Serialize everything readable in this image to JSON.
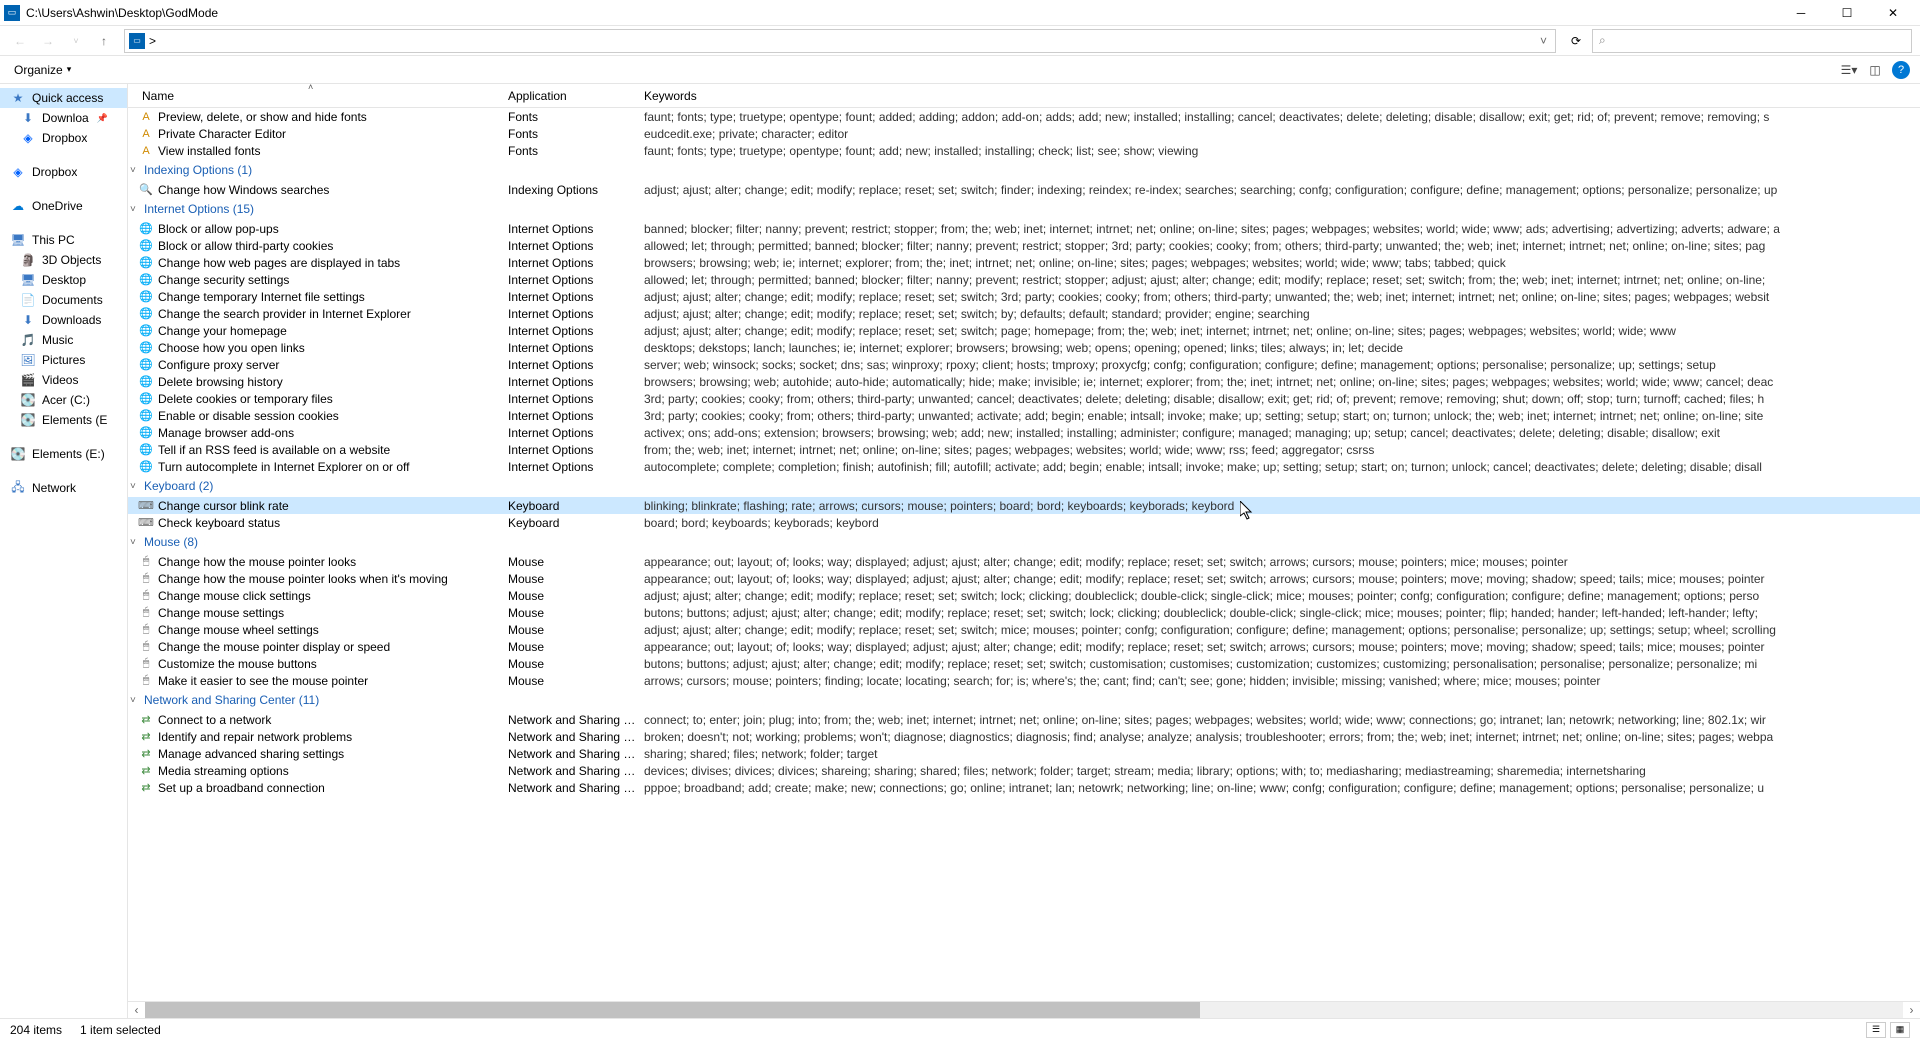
{
  "window": {
    "title": "C:\\Users\\Ashwin\\Desktop\\GodMode",
    "address": ">"
  },
  "toolbar": {
    "organize": "Organize"
  },
  "search": {
    "placeholder": ""
  },
  "sidebar": {
    "quick_access": "Quick access",
    "downloads_pin": "Downloa",
    "dropbox_pin": "Dropbox",
    "dropbox": "Dropbox",
    "onedrive": "OneDrive",
    "this_pc": "This PC",
    "objects3d": "3D Objects",
    "desktop": "Desktop",
    "documents": "Documents",
    "downloads": "Downloads",
    "music": "Music",
    "pictures": "Pictures",
    "videos": "Videos",
    "acer_c": "Acer (C:)",
    "elements_e1": "Elements (E",
    "elements_e2": "Elements (E:)",
    "network": "Network"
  },
  "columns": {
    "name": "Name",
    "app": "Application",
    "key": "Keywords"
  },
  "groups": [
    {
      "label": "",
      "items": [
        {
          "name": "Preview, delete, or show and hide fonts",
          "app": "Fonts",
          "key": "faunt; fonts; type; truetype; opentype; fount; added; adding; addon; add-on; adds; add; new; installed; installing; cancel; deactivates; delete; deleting; disable; disallow; exit; get; rid; of; prevent; remove; removing; s",
          "icon": "A",
          "ic": "#d08a00"
        },
        {
          "name": "Private Character Editor",
          "app": "Fonts",
          "key": "eudcedit.exe; private; character; editor",
          "icon": "A",
          "ic": "#d08a00"
        },
        {
          "name": "View installed fonts",
          "app": "Fonts",
          "key": "faunt; fonts; type; truetype; opentype; fount; add; new; installed; installing; check; list; see; show; viewing",
          "icon": "A",
          "ic": "#d08a00"
        }
      ]
    },
    {
      "label": "Indexing Options (1)",
      "items": [
        {
          "name": "Change how Windows searches",
          "app": "Indexing Options",
          "key": "adjust; ajust; alter; change; edit; modify; replace; reset; set; switch; finder; indexing; reindex; re-index; searches; searching; confg; configuration; configure; define; management; options; personalize; personalize; up",
          "icon": "🔍",
          "ic": "#888"
        }
      ]
    },
    {
      "label": "Internet Options (15)",
      "items": [
        {
          "name": "Block or allow pop-ups",
          "app": "Internet Options",
          "key": "banned; blocker; filter; nanny; prevent; restrict; stopper; from; the; web; inet; internet; intrnet; net; online; on-line; sites; pages; webpages; websites; world; wide; www; ads; advertising; advertizing; adverts; adware; a",
          "icon": "🌐",
          "ic": "#3b78c4"
        },
        {
          "name": "Block or allow third-party cookies",
          "app": "Internet Options",
          "key": "allowed; let; through; permitted; banned; blocker; filter; nanny; prevent; restrict; stopper; 3rd; party; cookies; cooky; from; others; third-party; unwanted; the; web; inet; internet; intrnet; net; online; on-line; sites; pag",
          "icon": "🌐",
          "ic": "#3b78c4"
        },
        {
          "name": "Change how web pages are displayed in tabs",
          "app": "Internet Options",
          "key": "browsers; browsing; web; ie; internet; explorer; from; the; inet; intrnet; net; online; on-line; sites; pages; webpages; websites; world; wide; www; tabs; tabbed; quick",
          "icon": "🌐",
          "ic": "#3b78c4"
        },
        {
          "name": "Change security settings",
          "app": "Internet Options",
          "key": "allowed; let; through; permitted; banned; blocker; filter; nanny; prevent; restrict; stopper; adjust; ajust; alter; change; edit; modify; replace; reset; set; switch; from; the; web; inet; internet; intrnet; net; online; on-line;",
          "icon": "🌐",
          "ic": "#3b78c4"
        },
        {
          "name": "Change temporary Internet file settings",
          "app": "Internet Options",
          "key": "adjust; ajust; alter; change; edit; modify; replace; reset; set; switch; 3rd; party; cookies; cooky; from; others; third-party; unwanted; the; web; inet; internet; intrnet; net; online; on-line; sites; pages; webpages; websit",
          "icon": "🌐",
          "ic": "#3b78c4"
        },
        {
          "name": "Change the search provider in Internet Explorer",
          "app": "Internet Options",
          "key": "adjust; ajust; alter; change; edit; modify; replace; reset; set; switch; by; defaults; default; standard; provider; engine; searching",
          "icon": "🌐",
          "ic": "#3b78c4"
        },
        {
          "name": "Change your homepage",
          "app": "Internet Options",
          "key": "adjust; ajust; alter; change; edit; modify; replace; reset; set; switch; page; homepage; from; the; web; inet; internet; intrnet; net; online; on-line; sites; pages; webpages; websites; world; wide; www",
          "icon": "🌐",
          "ic": "#3b78c4"
        },
        {
          "name": "Choose how you open links",
          "app": "Internet Options",
          "key": "desktops; dekstops; lanch; launches; ie; internet; explorer; browsers; browsing; web; opens; opening; opened; links; tiles; always; in; let; decide",
          "icon": "🌐",
          "ic": "#3b78c4"
        },
        {
          "name": "Configure proxy server",
          "app": "Internet Options",
          "key": "server; web; winsock; socks; socket; dns; sas; winproxy; rpoxy; client; hosts; tmproxy; proxycfg; confg; configuration; configure; define; management; options; personalise; personalize; up; settings; setup",
          "icon": "🌐",
          "ic": "#3b78c4"
        },
        {
          "name": "Delete browsing history",
          "app": "Internet Options",
          "key": "browsers; browsing; web; autohide; auto-hide; automatically; hide; make; invisible; ie; internet; explorer; from; the; inet; intrnet; net; online; on-line; sites; pages; webpages; websites; world; wide; www; cancel; deac",
          "icon": "🌐",
          "ic": "#3b78c4"
        },
        {
          "name": "Delete cookies or temporary files",
          "app": "Internet Options",
          "key": "3rd; party; cookies; cooky; from; others; third-party; unwanted; cancel; deactivates; delete; deleting; disable; disallow; exit; get; rid; of; prevent; remove; removing; shut; down; off; stop; turn; turnoff; cached; files; h",
          "icon": "🌐",
          "ic": "#3b78c4"
        },
        {
          "name": "Enable or disable session cookies",
          "app": "Internet Options",
          "key": "3rd; party; cookies; cooky; from; others; third-party; unwanted; activate; add; begin; enable; intsall; invoke; make; up; setting; setup; start; on; turnon; unlock; the; web; inet; internet; intrnet; net; online; on-line; site",
          "icon": "🌐",
          "ic": "#3b78c4"
        },
        {
          "name": "Manage browser add-ons",
          "app": "Internet Options",
          "key": "activex; ons; add-ons; extension; browsers; browsing; web; add; new; installed; installing; administer; configure; managed; managing; up; setup; cancel; deactivates; delete; deleting; disable; disallow; exit",
          "icon": "🌐",
          "ic": "#3b78c4"
        },
        {
          "name": "Tell if an RSS feed is available on a website",
          "app": "Internet Options",
          "key": "from; the; web; inet; internet; intrnet; net; online; on-line; sites; pages; webpages; websites; world; wide; www; rss; feed; aggregator; csrss",
          "icon": "🌐",
          "ic": "#3b78c4"
        },
        {
          "name": "Turn autocomplete in Internet Explorer on or off",
          "app": "Internet Options",
          "key": "autocomplete; complete; completion; finish; autofinish; fill; autofill; activate; add; begin; enable; intsall; invoke; make; up; setting; setup; start; on; turnon; unlock; cancel; deactivates; delete; deleting; disable; disall",
          "icon": "🌐",
          "ic": "#3b78c4"
        }
      ]
    },
    {
      "label": "Keyboard (2)",
      "items": [
        {
          "name": "Change cursor blink rate",
          "app": "Keyboard",
          "key": "blinking; blinkrate; flashing; rate; arrows; cursors; mouse; pointers; board; bord; keyboards; keyborads; keybord",
          "icon": "⌨",
          "ic": "#666",
          "selected": true
        },
        {
          "name": "Check keyboard status",
          "app": "Keyboard",
          "key": "board; bord; keyboards; keyborads; keybord",
          "icon": "⌨",
          "ic": "#666"
        }
      ]
    },
    {
      "label": "Mouse (8)",
      "items": [
        {
          "name": "Change how the mouse pointer looks",
          "app": "Mouse",
          "key": "appearance; out; layout; of; looks; way; displayed; adjust; ajust; alter; change; edit; modify; replace; reset; set; switch; arrows; cursors; mouse; pointers; mice; mouses; pointer",
          "icon": "🖱",
          "ic": "#666"
        },
        {
          "name": "Change how the mouse pointer looks when it's moving",
          "app": "Mouse",
          "key": "appearance; out; layout; of; looks; way; displayed; adjust; ajust; alter; change; edit; modify; replace; reset; set; switch; arrows; cursors; mouse; pointers; move; moving; shadow; speed; tails; mice; mouses; pointer",
          "icon": "🖱",
          "ic": "#666"
        },
        {
          "name": "Change mouse click settings",
          "app": "Mouse",
          "key": "adjust; ajust; alter; change; edit; modify; replace; reset; set; switch; lock; clicking; doubleclick; double-click; single-click; mice; mouses; pointer; confg; configuration; configure; define; management; options; perso",
          "icon": "🖱",
          "ic": "#666"
        },
        {
          "name": "Change mouse settings",
          "app": "Mouse",
          "key": "butons; buttons; adjust; ajust; alter; change; edit; modify; replace; reset; set; switch; lock; clicking; doubleclick; double-click; single-click; mice; mouses; pointer; flip; handed; hander; left-handed; left-hander; lefty;",
          "icon": "🖱",
          "ic": "#666"
        },
        {
          "name": "Change mouse wheel settings",
          "app": "Mouse",
          "key": "adjust; ajust; alter; change; edit; modify; replace; reset; set; switch; mice; mouses; pointer; confg; configuration; configure; define; management; options; personalise; personalize; up; settings; setup; wheel; scrolling",
          "icon": "🖱",
          "ic": "#666"
        },
        {
          "name": "Change the mouse pointer display or speed",
          "app": "Mouse",
          "key": "appearance; out; layout; of; looks; way; displayed; adjust; ajust; alter; change; edit; modify; replace; reset; set; switch; arrows; cursors; mouse; pointers; move; moving; shadow; speed; tails; mice; mouses; pointer",
          "icon": "🖱",
          "ic": "#666"
        },
        {
          "name": "Customize the mouse buttons",
          "app": "Mouse",
          "key": "butons; buttons; adjust; ajust; alter; change; edit; modify; replace; reset; set; switch; customisation; customises; customization; customizes; customizing; personalisation; personalise; personalize; personalize; mi",
          "icon": "🖱",
          "ic": "#666"
        },
        {
          "name": "Make it easier to see the mouse pointer",
          "app": "Mouse",
          "key": "arrows; cursors; mouse; pointers; finding; locate; locating; search; for; is; where's; the; cant; find; can't; see; gone; hidden; invisible; missing; vanished; where; mice; mouses; pointer",
          "icon": "🖱",
          "ic": "#666"
        }
      ]
    },
    {
      "label": "Network and Sharing Center (11)",
      "items": [
        {
          "name": "Connect to a network",
          "app": "Network and Sharing Center",
          "key": "connect; to; enter; join; plug; into; from; the; web; inet; internet; intrnet; net; online; on-line; sites; pages; webpages; websites; world; wide; www; connections; go; intranet; lan; netowrk; networking; line; 802.1x; wir",
          "icon": "⇄",
          "ic": "#3c8a3c"
        },
        {
          "name": "Identify and repair network problems",
          "app": "Network and Sharing Center",
          "key": "broken; doesn't; not; working; problems; won't; diagnose; diagnostics; diagnosis; find; analyse; analyze; analysis; troubleshooter; errors; from; the; web; inet; internet; intrnet; net; online; on-line; sites; pages; webpa",
          "icon": "⇄",
          "ic": "#3c8a3c"
        },
        {
          "name": "Manage advanced sharing settings",
          "app": "Network and Sharing Center",
          "key": "sharing; shared; files; network; folder; target",
          "icon": "⇄",
          "ic": "#3c8a3c"
        },
        {
          "name": "Media streaming options",
          "app": "Network and Sharing Center",
          "key": "devices; divises; divices; divices; shareing; sharing; shared; files; network; folder; target; stream; media; library; options; with; to; mediasharing; mediastreaming; sharemedia; internetsharing",
          "icon": "⇄",
          "ic": "#3c8a3c"
        },
        {
          "name": "Set up a broadband connection",
          "app": "Network and Sharing Center",
          "key": "pppoe; broadband; add; create; make; new; connections; go; online; intranet; lan; netowrk; networking; line; on-line; www; confg; configuration; configure; define; management; options; personalise; personalize; u",
          "icon": "⇄",
          "ic": "#3c8a3c"
        }
      ]
    }
  ],
  "statusbar": {
    "total": "204 items",
    "selected": "1 item selected"
  }
}
